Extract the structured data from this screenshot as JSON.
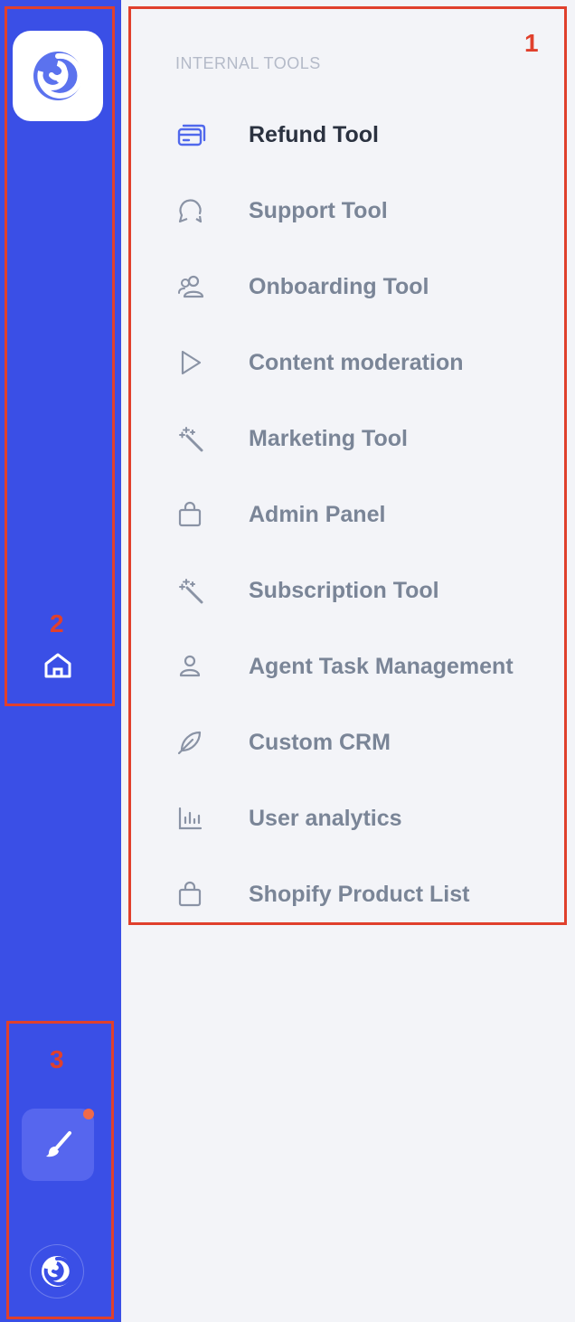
{
  "sidebar": {
    "brand_color": "#3a4fe6",
    "logo_icon": "swirl-logo-icon",
    "home_icon": "home-icon",
    "theme_icon": "paintbrush-icon",
    "notification_dot_color": "#ef6a4a",
    "avatar_icon": "swirl-avatar-icon"
  },
  "menu": {
    "section_label": "INTERNAL TOOLS",
    "items": [
      {
        "label": "Refund Tool",
        "icon": "card-stack-icon",
        "active": true
      },
      {
        "label": "Support Tool",
        "icon": "chat-bubble-icon"
      },
      {
        "label": "Onboarding Tool",
        "icon": "users-icon"
      },
      {
        "label": "Content moderation",
        "icon": "play-icon"
      },
      {
        "label": "Marketing Tool",
        "icon": "magic-wand-icon"
      },
      {
        "label": "Admin Panel",
        "icon": "bag-icon"
      },
      {
        "label": "Subscription Tool",
        "icon": "magic-wand-icon"
      },
      {
        "label": "Agent Task Management",
        "icon": "user-icon"
      },
      {
        "label": "Custom CRM",
        "icon": "feather-icon"
      },
      {
        "label": "User analytics",
        "icon": "bar-chart-icon"
      },
      {
        "label": "Shopify Product List",
        "icon": "bag-icon"
      }
    ]
  },
  "annotations": {
    "labels": [
      "1",
      "2",
      "3"
    ],
    "color": "#e0402c"
  }
}
